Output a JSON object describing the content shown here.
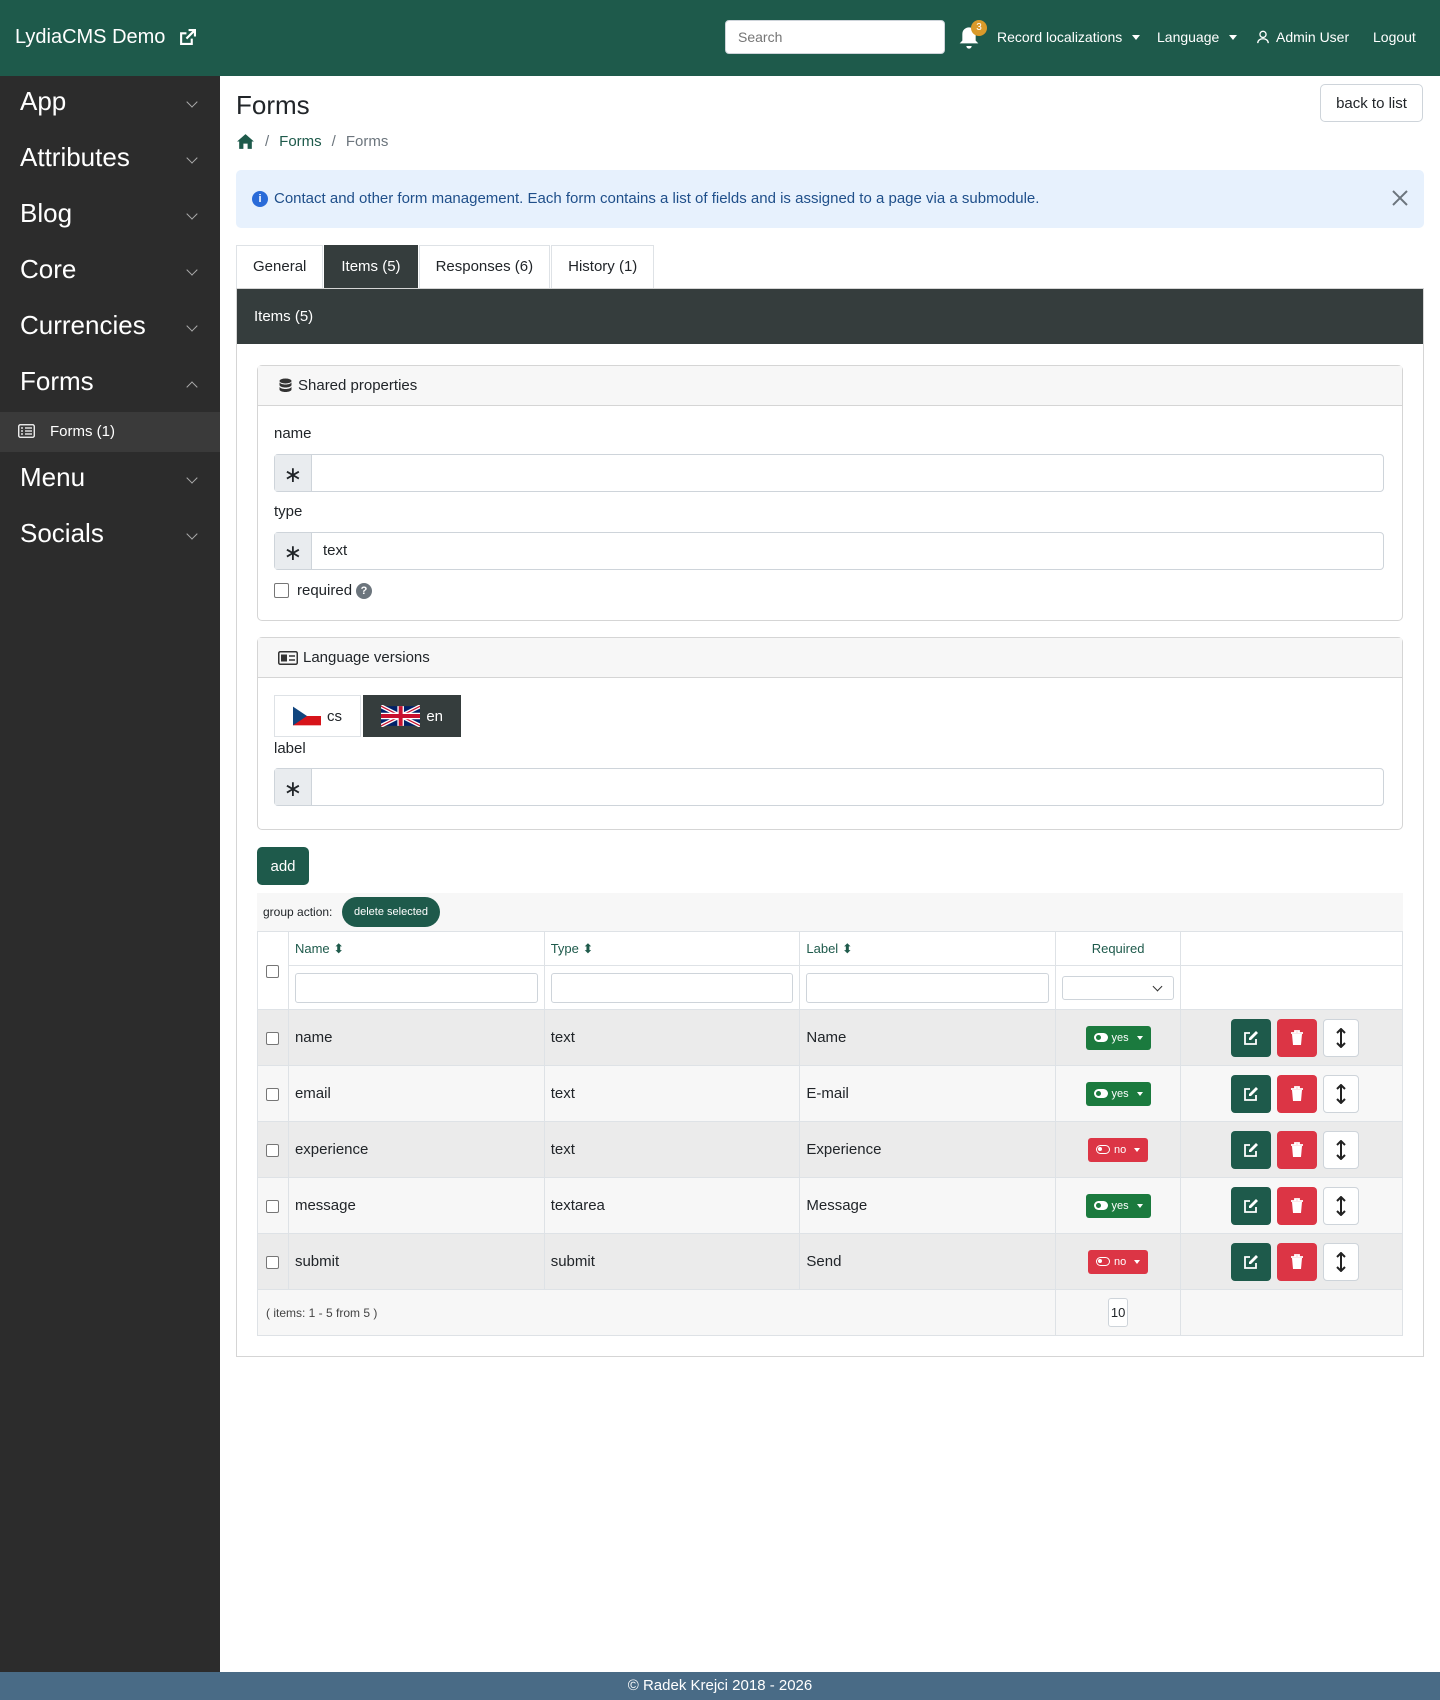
{
  "topbar": {
    "brand": "LydiaCMS Demo",
    "search_placeholder": "Search",
    "notifications_count": "3",
    "record_localizations": "Record localizations",
    "language": "Language",
    "user": "Admin User",
    "logout": "Logout"
  },
  "sidebar": {
    "items": [
      {
        "label": "App"
      },
      {
        "label": "Attributes"
      },
      {
        "label": "Blog"
      },
      {
        "label": "Core"
      },
      {
        "label": "Currencies"
      },
      {
        "label": "Forms"
      },
      {
        "label": "Menu"
      },
      {
        "label": "Socials"
      }
    ],
    "sub_item": "Forms (1)"
  },
  "page": {
    "title": "Forms",
    "back_button": "back to list",
    "breadcrumb": [
      "Forms",
      "Forms"
    ],
    "alert": "Contact and other form management. Each form contains a list of fields and is assigned to a page via a submodule."
  },
  "tabs": [
    "General",
    "Items (5)",
    "Responses (6)",
    "History (1)"
  ],
  "panel_title": "Items (5)",
  "shared": {
    "title": "Shared properties",
    "name_label": "name",
    "name_value": "",
    "type_label": "type",
    "type_value": "text",
    "required_label": "required"
  },
  "lang_versions": {
    "title": "Language versions",
    "tabs": [
      "cs",
      "en"
    ],
    "label_label": "label",
    "label_value": ""
  },
  "add_button": "add",
  "group_action": {
    "label": "group action:",
    "button": "delete selected"
  },
  "table": {
    "headers": [
      "Name",
      "Type",
      "Label",
      "Required"
    ],
    "rows": [
      {
        "name": "name",
        "type": "text",
        "label": "Name",
        "required": "yes"
      },
      {
        "name": "email",
        "type": "text",
        "label": "E-mail",
        "required": "yes"
      },
      {
        "name": "experience",
        "type": "text",
        "label": "Experience",
        "required": "no"
      },
      {
        "name": "message",
        "type": "textarea",
        "label": "Message",
        "required": "yes"
      },
      {
        "name": "submit",
        "type": "submit",
        "label": "Send",
        "required": "no"
      }
    ],
    "summary": "( items: 1 - 5 from 5 )",
    "per_page": "10"
  },
  "footer": "© Radek Krejci 2018 - 2026",
  "colors": {
    "primary": "#1e5a4b",
    "sidebar": "#2c2c2c",
    "danger": "#dc3545",
    "success": "#1b7a3e",
    "footer": "#496b86"
  }
}
